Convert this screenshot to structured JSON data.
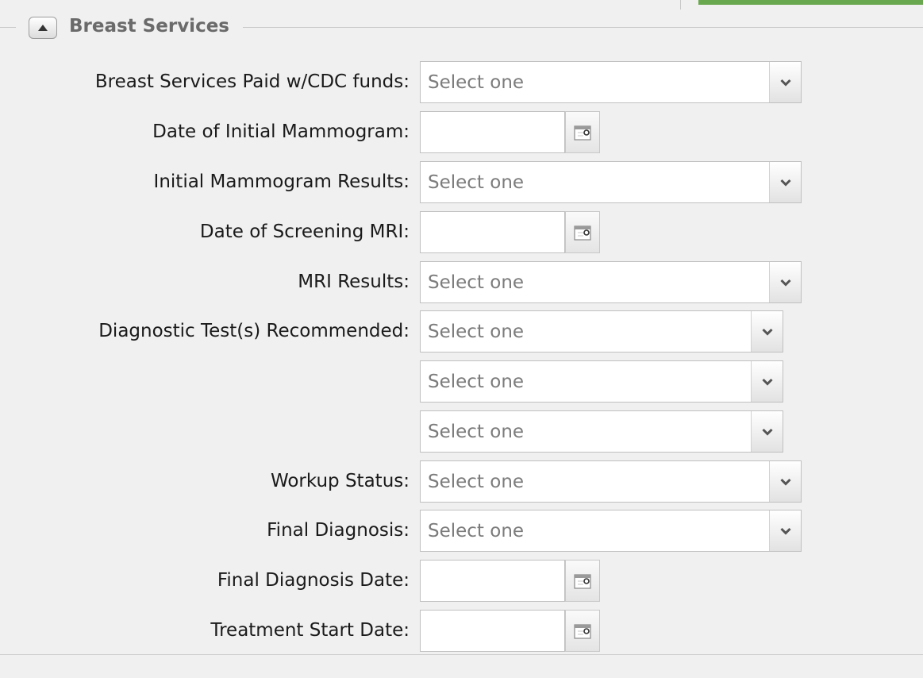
{
  "section": {
    "title": "Breast Services",
    "collapse_icon": "collapse-up-icon"
  },
  "fields": {
    "paid_cdc": {
      "label": "Breast Services Paid w/CDC funds:",
      "value": "Select one"
    },
    "initial_mammogram_date": {
      "label": "Date of Initial Mammogram:",
      "value": ""
    },
    "initial_mammogram_results": {
      "label": "Initial Mammogram Results:",
      "value": "Select one"
    },
    "screening_mri_date": {
      "label": "Date of Screening MRI:",
      "value": ""
    },
    "mri_results": {
      "label": "MRI Results:",
      "value": "Select one"
    },
    "diagnostic_tests": {
      "label": "Diagnostic Test(s) Recommended:",
      "values": [
        "Select one",
        "Select one",
        "Select one"
      ]
    },
    "workup_status": {
      "label": "Workup Status:",
      "value": "Select one"
    },
    "final_diagnosis": {
      "label": "Final Diagnosis:",
      "value": "Select one"
    },
    "final_diagnosis_date": {
      "label": "Final Diagnosis Date:",
      "value": ""
    },
    "treatment_start_date": {
      "label": "Treatment Start Date:",
      "value": ""
    }
  },
  "colors": {
    "accent_green": "#6aa84f",
    "label_text": "#1a1a1a",
    "placeholder_text": "#7c7c7c",
    "legend_text": "#6a6a6a"
  }
}
